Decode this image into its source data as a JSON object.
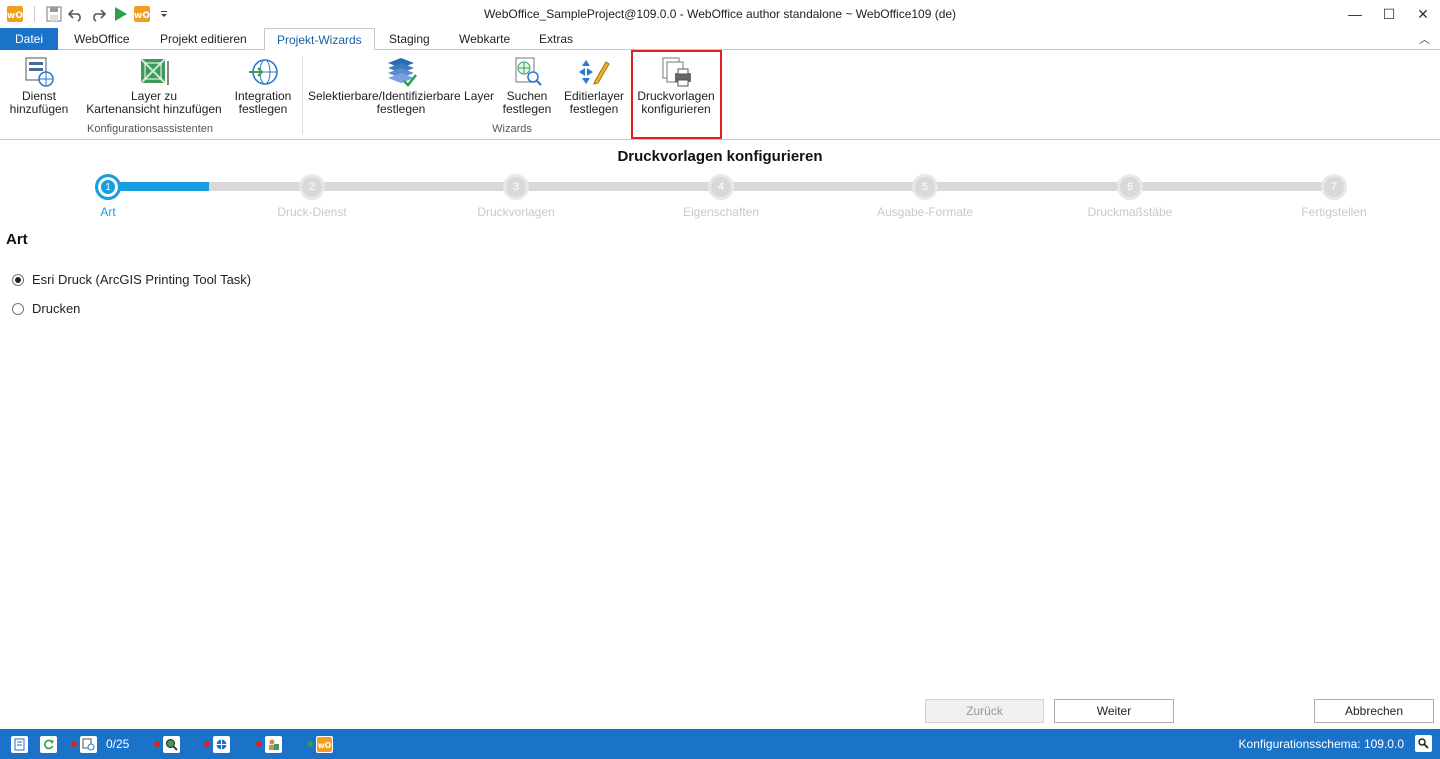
{
  "window": {
    "title": "WebOffice_SampleProject@109.0.0 - WebOffice author standalone ~ WebOffice109 (de)",
    "minimize": "—",
    "maximize": "☐",
    "close": "✕"
  },
  "tabs": [
    {
      "label": "Datei"
    },
    {
      "label": "WebOffice"
    },
    {
      "label": "Projekt editieren"
    },
    {
      "label": "Projekt-Wizards"
    },
    {
      "label": "Staging"
    },
    {
      "label": "Webkarte"
    },
    {
      "label": "Extras"
    }
  ],
  "ribbon": {
    "group1_label": "Konfigurationsassistenten",
    "group2_label": "Wizards",
    "buttons": [
      {
        "line1": "Dienst",
        "line2": "hinzufügen"
      },
      {
        "line1": "Layer zu",
        "line2": "Kartenansicht hinzufügen"
      },
      {
        "line1": "Integration",
        "line2": "festlegen"
      },
      {
        "line1": "Selektierbare/Identifizierbare Layer",
        "line2": "festlegen"
      },
      {
        "line1": "Suchen",
        "line2": "festlegen"
      },
      {
        "line1": "Editierlayer",
        "line2": "festlegen"
      },
      {
        "line1": "Druckvorlagen",
        "line2": "konfigurieren"
      }
    ]
  },
  "wizard": {
    "title": "Druckvorlagen konfigurieren",
    "progress_fraction": 0.08,
    "steps": [
      {
        "num": "1",
        "label": "Art"
      },
      {
        "num": "2",
        "label": "Druck-Dienst"
      },
      {
        "num": "3",
        "label": "Druckvorlagen"
      },
      {
        "num": "4",
        "label": "Eigenschaften"
      },
      {
        "num": "5",
        "label": "Ausgabe-Formate"
      },
      {
        "num": "6",
        "label": "Druckmaßstäbe"
      },
      {
        "num": "7",
        "label": "Fertigstellen"
      }
    ],
    "section_title": "Art",
    "options": [
      {
        "label": "Esri Druck (ArcGIS Printing Tool Task)",
        "checked": true
      },
      {
        "label": "Drucken",
        "checked": false
      }
    ],
    "back_label": "Zurück",
    "next_label": "Weiter",
    "cancel_label": "Abbrechen"
  },
  "statusbar": {
    "count": "0/25",
    "schema": "Konfigurationsschema: 109.0.0"
  },
  "colors": {
    "accent": "#1a9ce0",
    "statusbar": "#1a73c8",
    "highlight": "#e02020"
  }
}
